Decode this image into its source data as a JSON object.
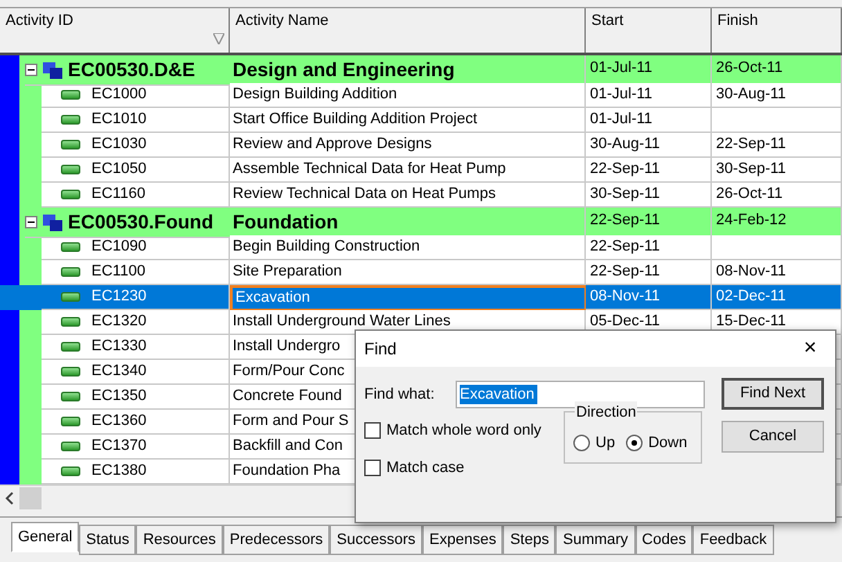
{
  "table": {
    "columns": [
      "Activity ID",
      "Activity Name",
      "Start",
      "Finish"
    ],
    "rows": [
      {
        "kind": "group",
        "id": "EC00530.D&E",
        "name": "Design and Engineering",
        "start": "01-Jul-11",
        "finish": "26-Oct-11",
        "selected": false,
        "expanded": true
      },
      {
        "kind": "activity",
        "id": "EC1000",
        "name": "Design Building Addition",
        "start": "01-Jul-11",
        "finish": "30-Aug-11",
        "selected": false
      },
      {
        "kind": "activity",
        "id": "EC1010",
        "name": "Start Office Building Addition Project",
        "start": "01-Jul-11",
        "selected": false
      },
      {
        "kind": "activity",
        "id": "EC1030",
        "name": "Review and Approve Designs",
        "start": "30-Aug-11",
        "finish": "22-Sep-11",
        "selected": false
      },
      {
        "kind": "activity",
        "id": "EC1050",
        "name": "Assemble Technical Data for Heat Pump",
        "start": "22-Sep-11",
        "finish": "30-Sep-11",
        "selected": false
      },
      {
        "kind": "activity",
        "id": "EC1160",
        "name": "Review Technical Data on Heat Pumps",
        "start": "30-Sep-11",
        "finish": "26-Oct-11",
        "selected": false
      },
      {
        "kind": "group",
        "id": "EC00530.Found",
        "name": "Foundation",
        "start": "22-Sep-11",
        "finish": "24-Feb-12",
        "selected": false,
        "expanded": true
      },
      {
        "kind": "activity",
        "id": "EC1090",
        "name": "Begin Building Construction",
        "start": "22-Sep-11",
        "selected": false
      },
      {
        "kind": "activity",
        "id": "EC1100",
        "name": "Site Preparation",
        "start": "22-Sep-11",
        "finish": "08-Nov-11",
        "selected": false
      },
      {
        "kind": "activity",
        "id": "EC1230",
        "name": "Excavation",
        "start": "08-Nov-11",
        "finish": "02-Dec-11",
        "selected": true
      },
      {
        "kind": "activity",
        "id": "EC1320",
        "name": "Install Underground Water Lines",
        "start": "05-Dec-11",
        "finish": "15-Dec-11",
        "selected": false
      },
      {
        "kind": "activity",
        "id": "EC1330",
        "name": "Install Undergro",
        "selected": false
      },
      {
        "kind": "activity",
        "id": "EC1340",
        "name": "Form/Pour Conc",
        "selected": false
      },
      {
        "kind": "activity",
        "id": "EC1350",
        "name": "Concrete Found",
        "selected": false
      },
      {
        "kind": "activity",
        "id": "EC1360",
        "name": "Form and Pour S",
        "selected": false
      },
      {
        "kind": "activity",
        "id": "EC1370",
        "name": "Backfill and Con",
        "selected": false
      },
      {
        "kind": "activity",
        "id": "EC1380",
        "name": "Foundation Pha",
        "selected": false
      }
    ]
  },
  "tabs": [
    {
      "label": "General",
      "selected": true
    },
    {
      "label": "Status",
      "selected": false
    },
    {
      "label": "Resources",
      "selected": false
    },
    {
      "label": "Predecessors",
      "selected": false
    },
    {
      "label": "Successors",
      "selected": false
    },
    {
      "label": "Expenses",
      "selected": false
    },
    {
      "label": "Steps",
      "selected": false
    },
    {
      "label": "Summary",
      "selected": false
    },
    {
      "label": "Codes",
      "selected": false
    },
    {
      "label": "Feedback",
      "selected": false
    }
  ],
  "find_dialog": {
    "title": "Find",
    "close": "×",
    "find_label": "Find what:",
    "find_value": "Excavation",
    "buttons": [
      "Find Next",
      "Cancel"
    ],
    "options": [
      {
        "label": "Match whole word only",
        "checked": false
      },
      {
        "label": "Match case",
        "checked": false
      }
    ],
    "direction": {
      "label": "Direction",
      "options": [
        {
          "label": "Up",
          "selected": false
        },
        {
          "label": "Down",
          "selected": true
        }
      ]
    }
  }
}
